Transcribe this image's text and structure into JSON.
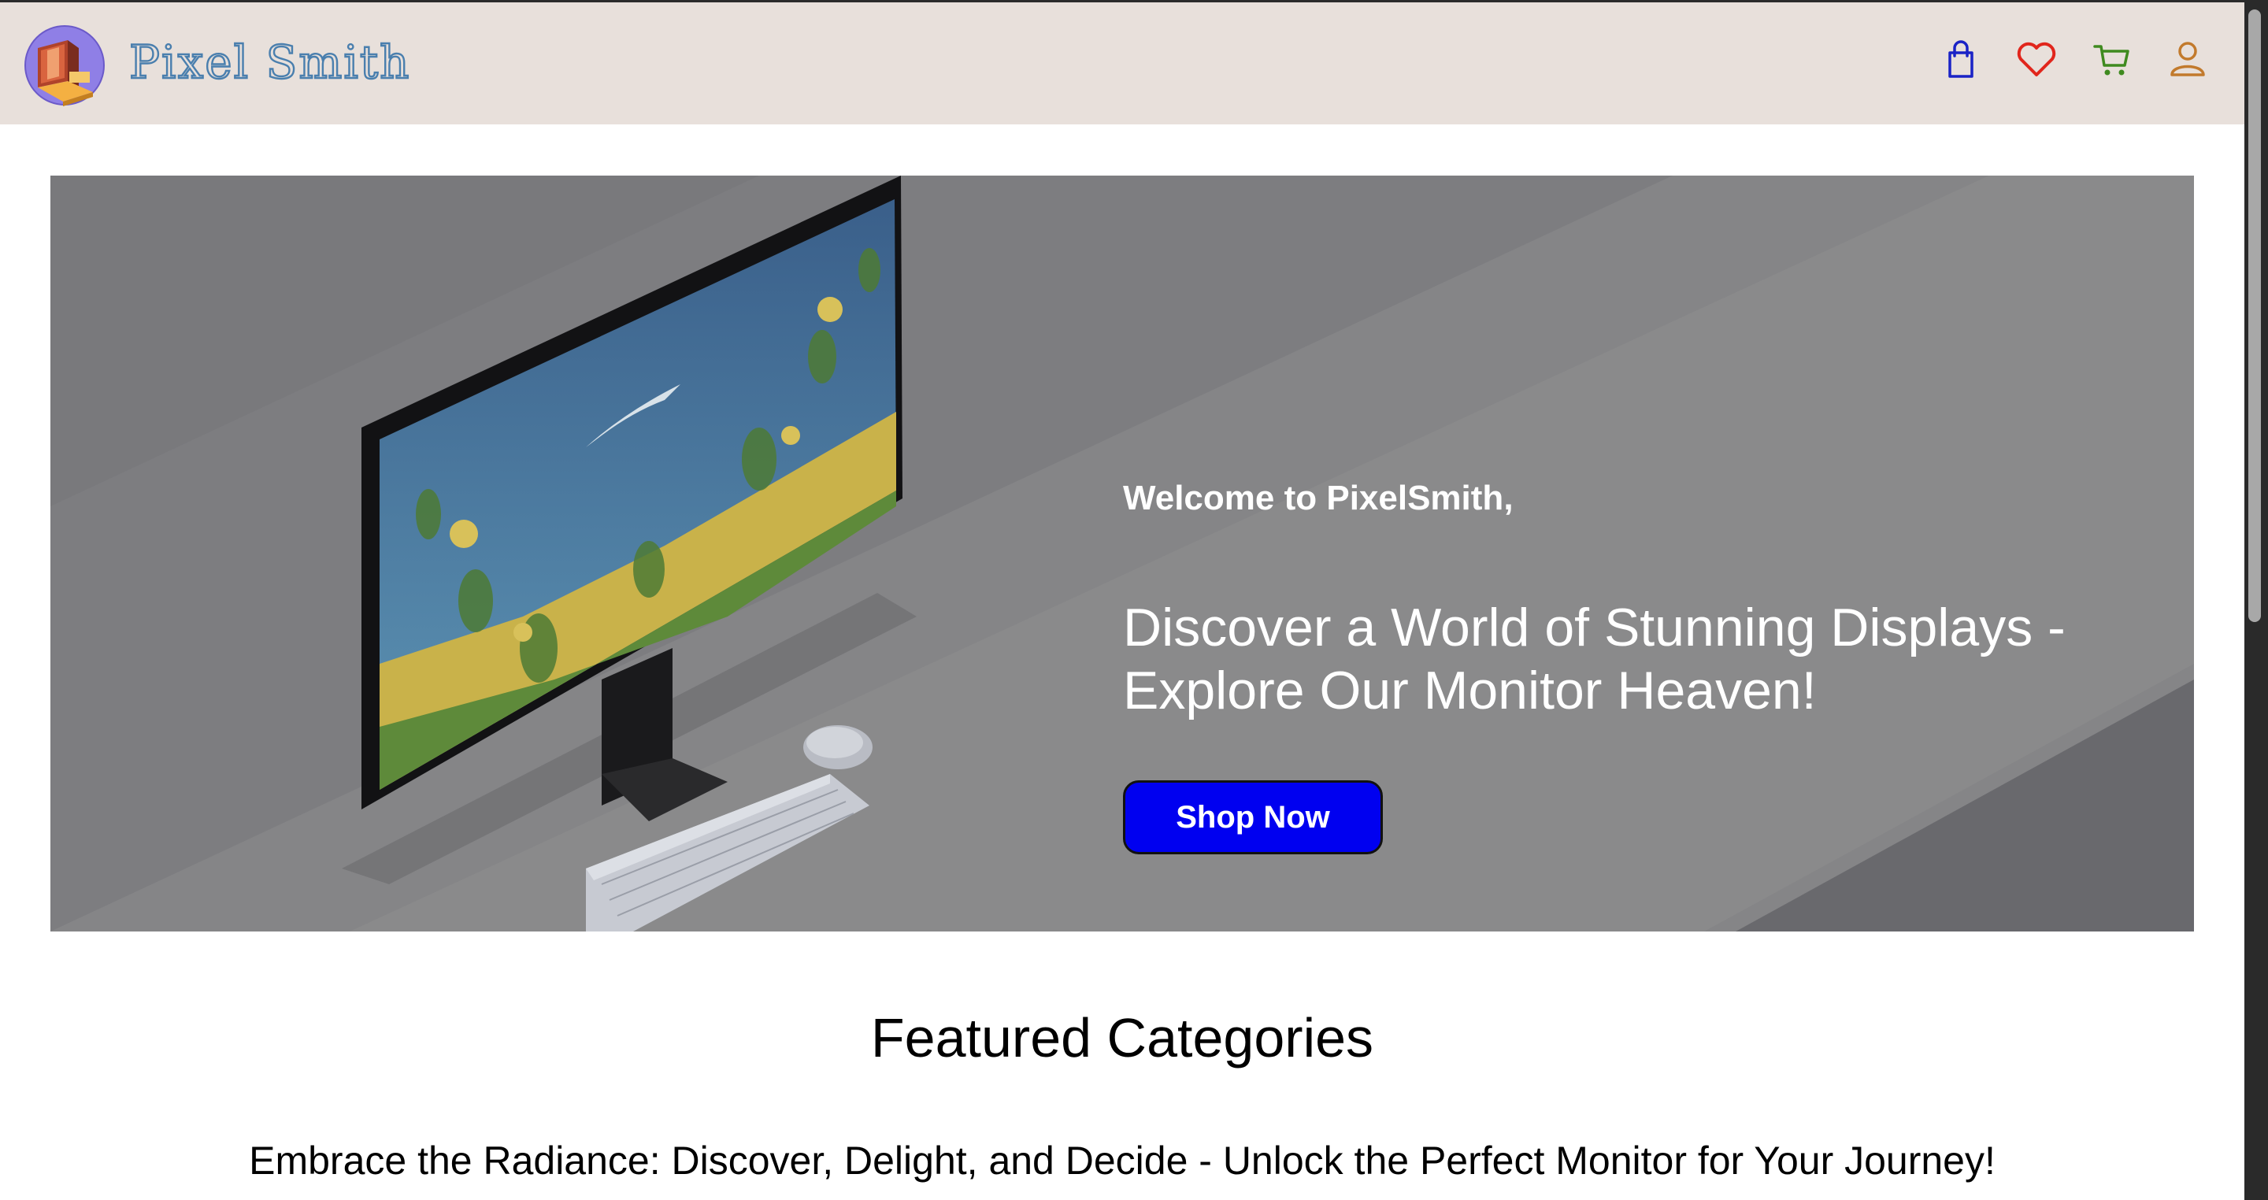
{
  "header": {
    "brand": "Pixel Smith",
    "icons": [
      {
        "name": "bag-icon",
        "color": "#1a23c6"
      },
      {
        "name": "heart-icon",
        "color": "#e1261c"
      },
      {
        "name": "cart-icon",
        "color": "#3f8a1f"
      },
      {
        "name": "user-icon",
        "color": "#c27a2c"
      }
    ],
    "background": "#e8e0db",
    "brand_color": "#4a7fae"
  },
  "hero": {
    "welcome": "Welcome to PixelSmith,",
    "headline": "Discover a World of Stunning Displays - Explore Our Monitor Heaven!",
    "cta_label": "Shop Now",
    "cta_color": "#0000f0"
  },
  "featured": {
    "title": "Featured Categories",
    "subtitle": "Embrace the Radiance: Discover, Delight, and Decide - Unlock the Perfect Monitor for Your Journey!"
  }
}
